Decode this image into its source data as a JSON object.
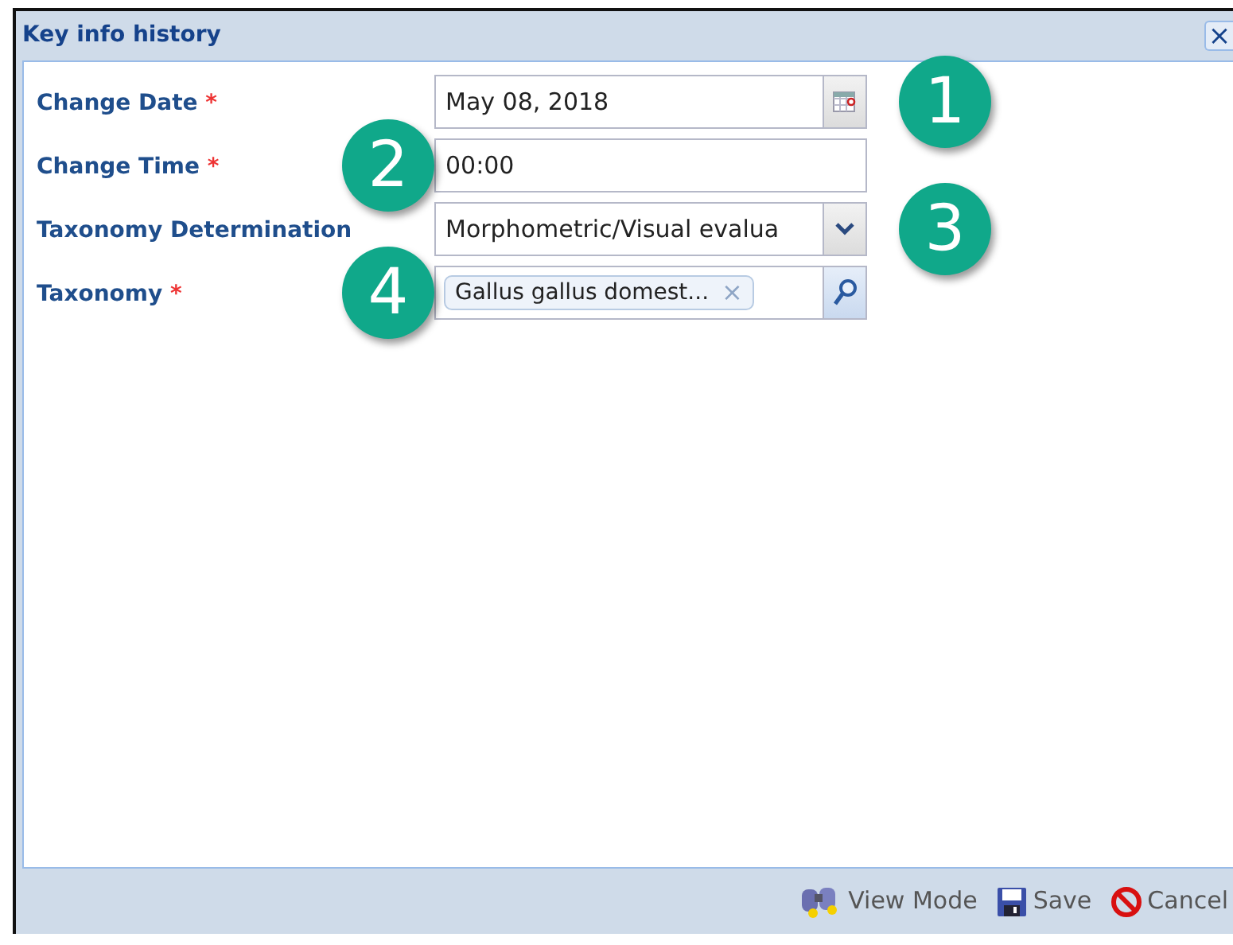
{
  "window": {
    "title": "Key info history",
    "close": "×"
  },
  "fields": [
    {
      "kind": "date",
      "label": "Change Date",
      "required": true,
      "value": "May 08, 2018",
      "callout": "1",
      "callout_left": false
    },
    {
      "kind": "text",
      "label": "Change Time",
      "required": true,
      "value": "00:00",
      "callout": "2",
      "callout_left": true
    },
    {
      "kind": "select",
      "label": "Taxonomy Determination",
      "required": false,
      "value": "Morphometric/Visual evalua",
      "callout": "3",
      "callout_left": false
    },
    {
      "kind": "tag",
      "label": "Taxonomy",
      "required": true,
      "value": "Gallus gallus domest...",
      "remove": "×",
      "callout": "4",
      "callout_left": true
    }
  ],
  "required_mark": "*",
  "buttons": [
    {
      "kind": "view",
      "label": "View Mode"
    },
    {
      "kind": "save",
      "label": "Save"
    },
    {
      "kind": "cancel",
      "label": "Cancel"
    }
  ]
}
